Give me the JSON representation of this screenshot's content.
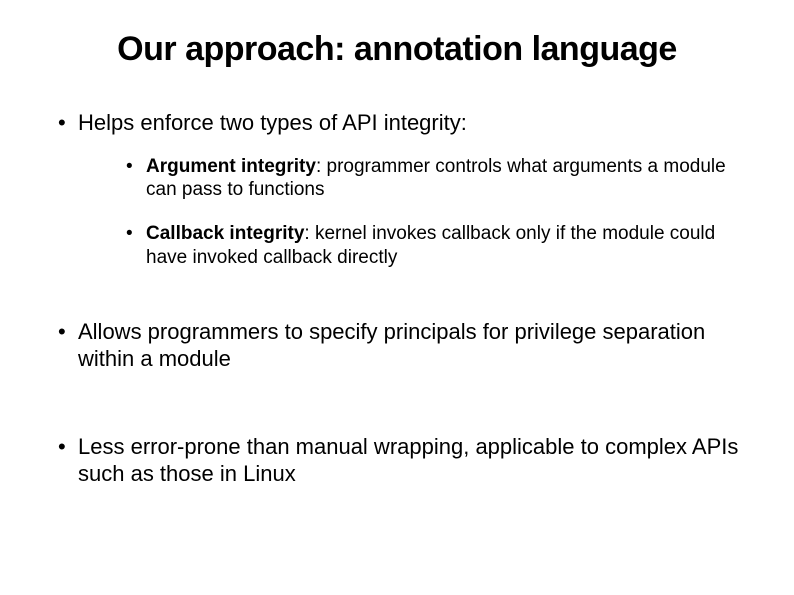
{
  "title": "Our approach: annotation language",
  "bullets": {
    "b1": "Helps enforce two types of API integrity:",
    "b1a_bold": "Argument integrity",
    "b1a_rest": ": programmer controls what arguments a module can pass to functions",
    "b1b_bold": "Callback integrity",
    "b1b_rest": ": kernel invokes callback only if the module could have invoked callback directly",
    "b2": "Allows programmers to specify principals for privilege separation within a module",
    "b3": "Less error-prone than manual wrapping, applicable to complex APIs such as those in Linux"
  }
}
